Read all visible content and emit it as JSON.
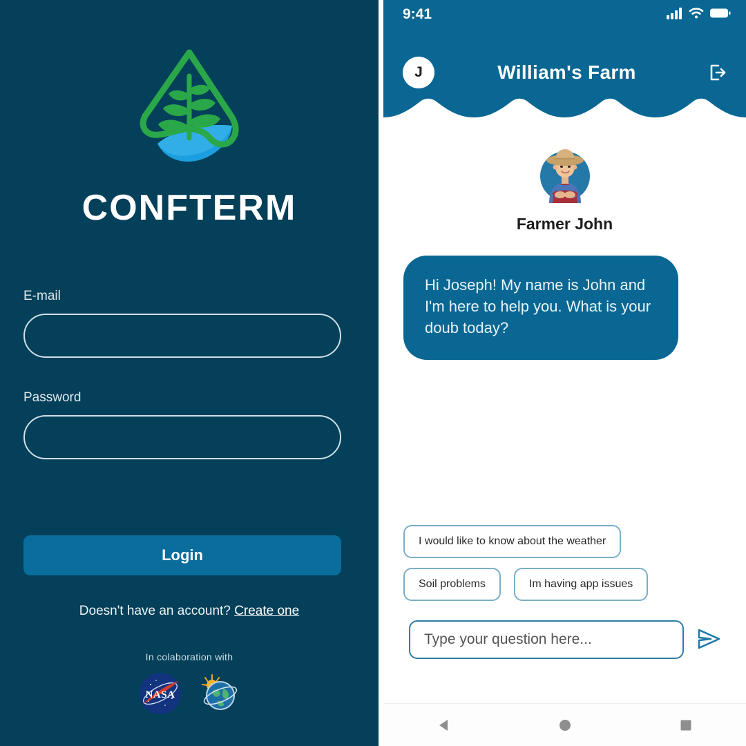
{
  "login": {
    "brand_name": "CONFTERM",
    "logo_icon": "leaf-water-drop-logo",
    "email_label": "E-mail",
    "email_value": "",
    "email_placeholder": "",
    "password_label": "Password",
    "password_value": "",
    "password_placeholder": "",
    "login_button": "Login",
    "signup_prompt": "Doesn't have an account?",
    "signup_link": "Create one",
    "collab_title": "In colaboration with",
    "partners": [
      {
        "name": "NASA",
        "icon": "nasa-logo",
        "label": "NASA"
      },
      {
        "name": "Globe Program",
        "icon": "globe-sun-logo",
        "label": ""
      }
    ],
    "colors": {
      "background": "#044059",
      "button": "#0a6d9c",
      "logo_green": "#2aa849",
      "logo_blue": "#1b9fe0",
      "field_border": "#cfe0e8"
    }
  },
  "phone": {
    "status_bar": {
      "time": "9:41",
      "signal_icon": "cellular-signal-icon",
      "wifi_icon": "wifi-icon",
      "battery_icon": "battery-full-icon"
    },
    "header": {
      "avatar_initial": "J",
      "title": "William's Farm",
      "logout_icon": "logout-icon"
    },
    "bot": {
      "avatar_icon": "farmer-avatar-icon",
      "name": "Farmer John"
    },
    "messages": [
      {
        "sender": "Farmer John",
        "text": "Hi Joseph! My name is John and I'm here to help you. What is your doub today?"
      }
    ],
    "suggestions": [
      "I would like to know about the weather",
      "Soil problems",
      "Im having app issues"
    ],
    "composer": {
      "value": "",
      "placeholder": "Type your question here...",
      "send_icon": "send-paper-plane-icon"
    },
    "nav_bar": {
      "back_icon": "back-triangle-icon",
      "home_icon": "home-circle-icon",
      "recents_icon": "recents-square-icon"
    },
    "colors": {
      "header": "#0a6793",
      "bubble": "#0a6793",
      "chip_border": "#7aaec6",
      "input_border": "#2d7ca5"
    }
  }
}
